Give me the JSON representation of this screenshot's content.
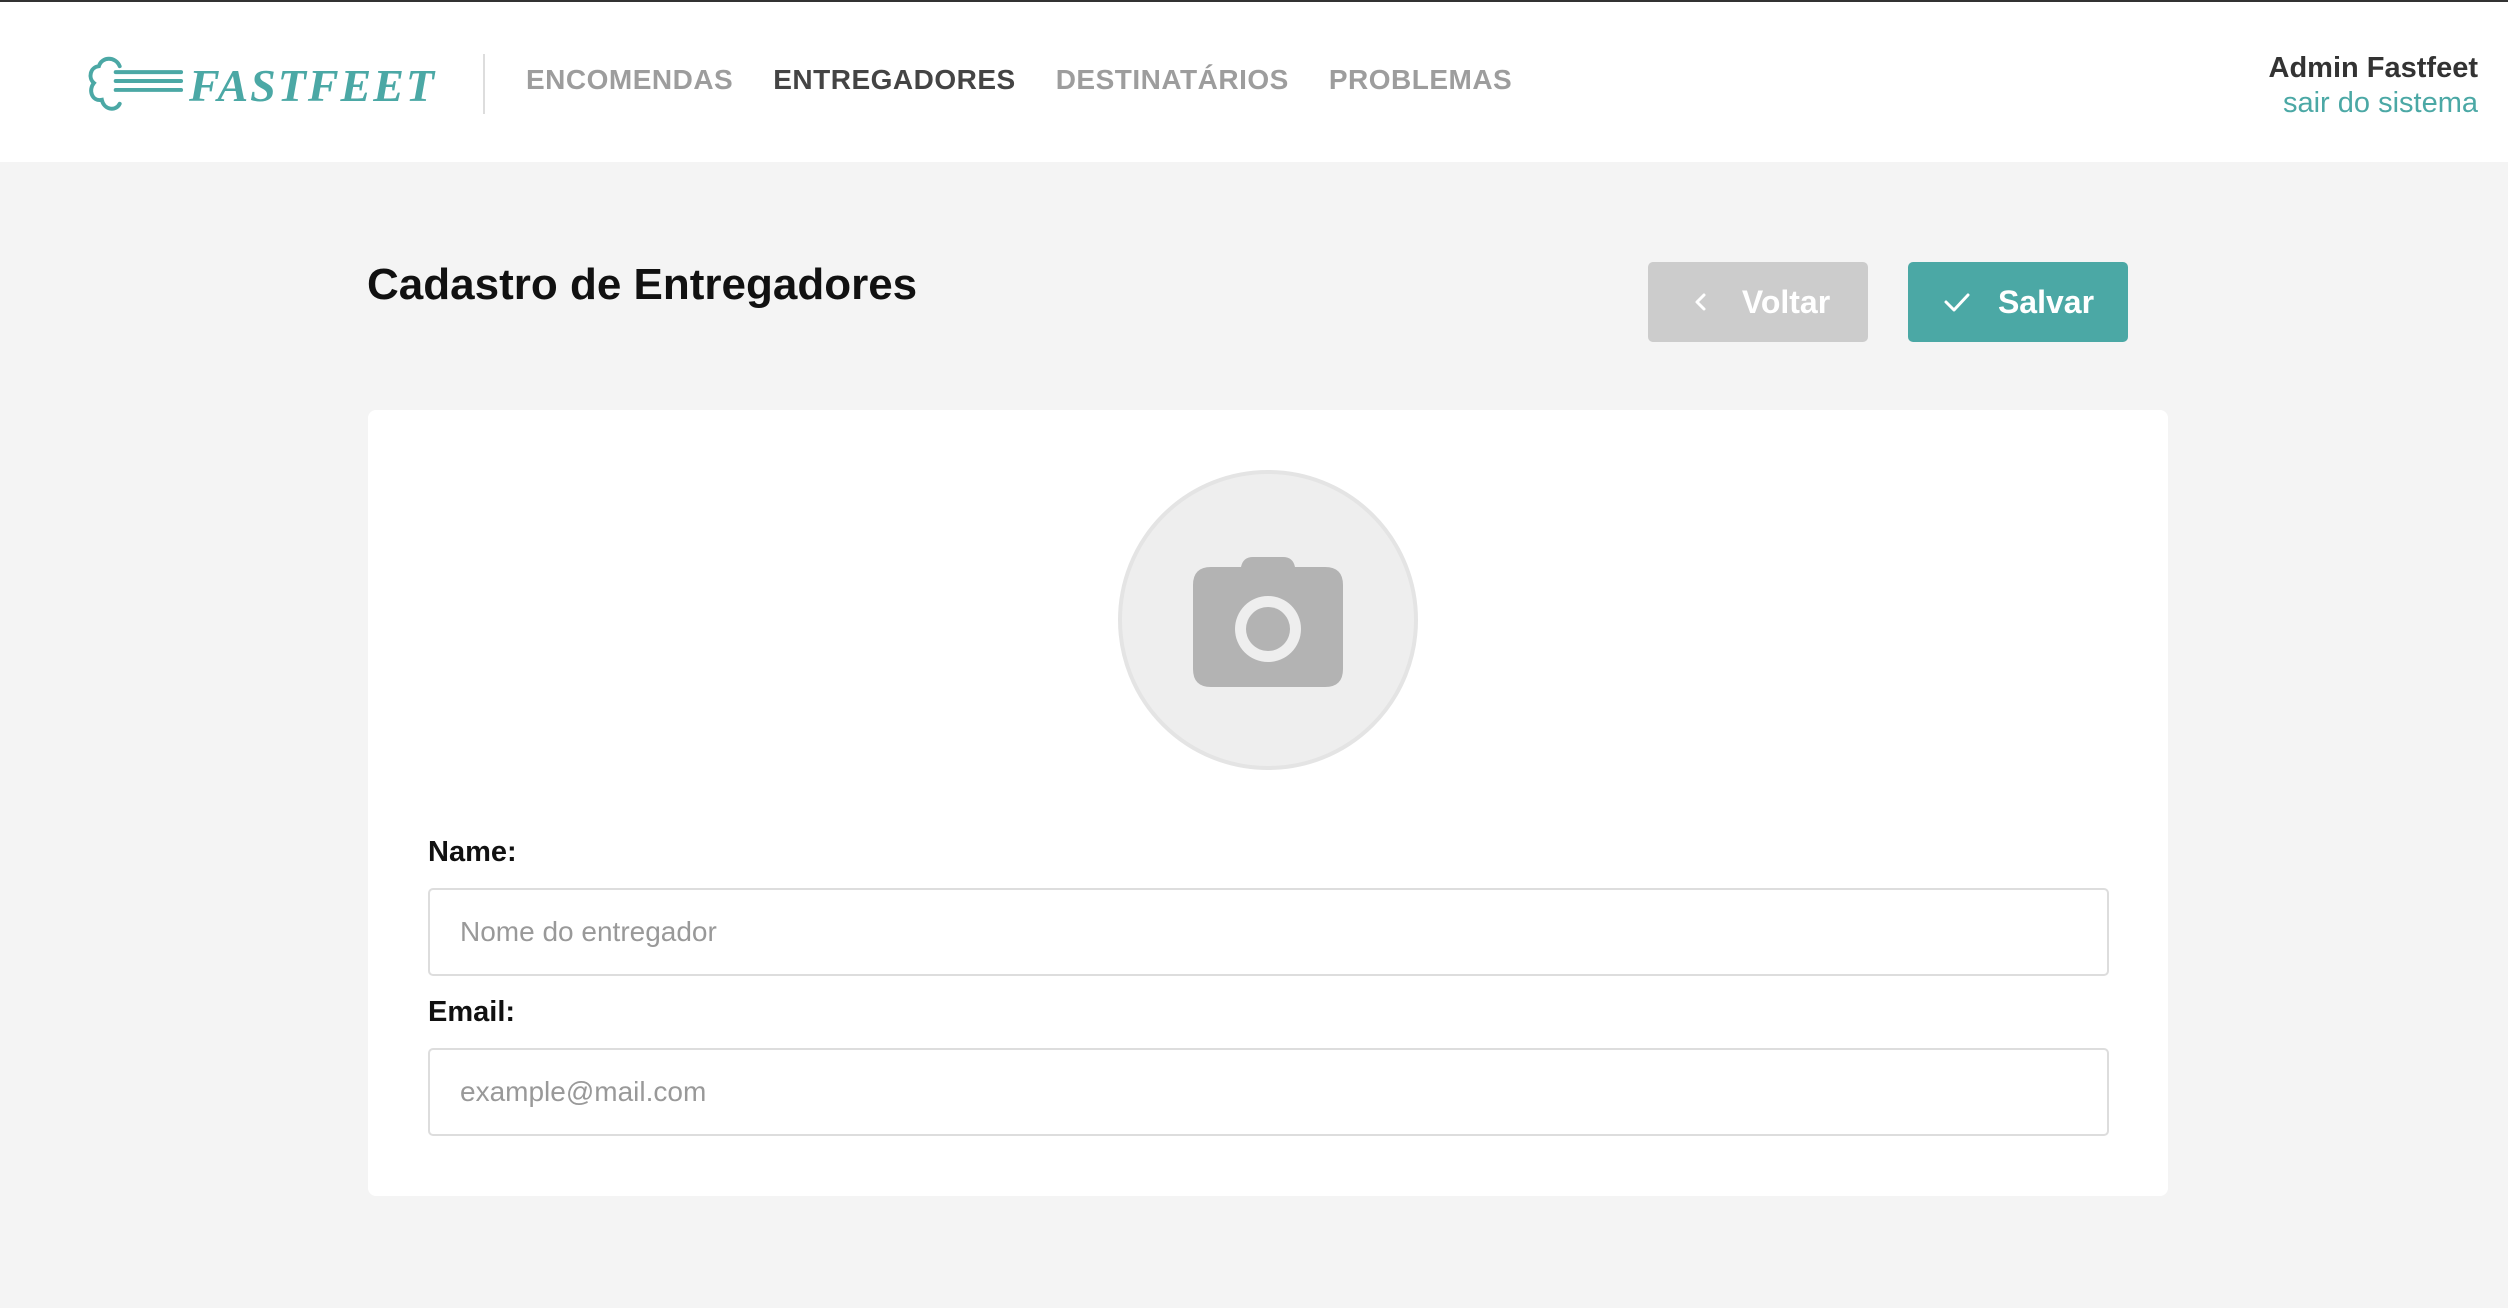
{
  "brand": {
    "name": "FASTFEET",
    "color": "#4ba8a5"
  },
  "nav": {
    "items": [
      {
        "label": "ENCOMENDAS",
        "active": false
      },
      {
        "label": "ENTREGADORES",
        "active": true
      },
      {
        "label": "DESTINATÁRIOS",
        "active": false
      },
      {
        "label": "PROBLEMAS",
        "active": false
      }
    ]
  },
  "user": {
    "name": "Admin Fastfeet",
    "logout_label": "sair do sistema"
  },
  "page": {
    "title": "Cadastro de Entregadores"
  },
  "actions": {
    "back_label": "Voltar",
    "back_icon": "chevron-left-icon",
    "save_label": "Salvar",
    "save_icon": "check-icon"
  },
  "form": {
    "avatar_icon": "camera-icon",
    "name": {
      "label": "Name:",
      "placeholder": "Nome do entregador",
      "value": ""
    },
    "email": {
      "label": "Email:",
      "placeholder": "example@mail.com",
      "value": ""
    }
  }
}
